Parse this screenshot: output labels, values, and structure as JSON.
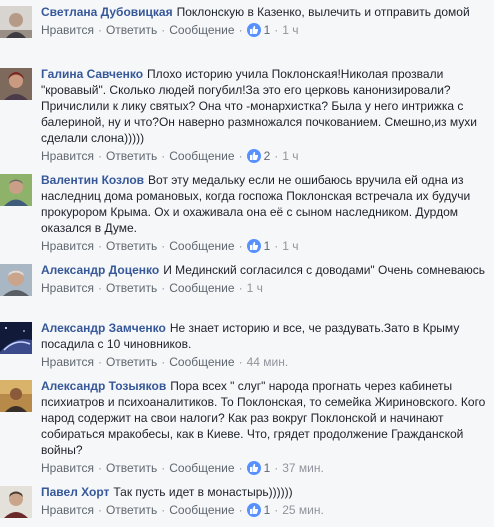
{
  "actions": {
    "like": "Нравится",
    "reply": "Ответить",
    "message": "Сообщение",
    "separator": "·",
    "like_icon": "thumbs-up-icon",
    "like_color": "#5890ff"
  },
  "comments": [
    {
      "author": "Светлана Дубовицкая",
      "text": "Поклонскую в Казенко, вылечить и отправить домой",
      "likes": "1",
      "time": "1 ч"
    },
    {
      "author": "Галина Савченко",
      "text": "Плохо историю учила Поклонская!Николая прозвали \"кровавый\". Сколько людей погубил!За это его церковь канонизировали? Причислили к лику святых? Она что -монархистка? Была у него интрижка с балериной, ну и что?Он наверно размножался почкованием. Смешно,из мухи сделали слона)))))",
      "likes": "2",
      "time": "1 ч"
    },
    {
      "author": "Валентин Козлов",
      "text": "Вот эту медальку если не ошибаюсь вручила ей одна из наследниц дома романовых, когда госпожа Поклонская встречала их будучи прокурором Крыма. Ох и охаживала она её с сыном наследником. Дурдом оказался в Думе.",
      "likes": "1",
      "time": "1 ч"
    },
    {
      "author": "Александр Доценко",
      "text": "И Мединский согласился с доводами\" Очень сомневаюсь",
      "likes": "",
      "time": "1 ч"
    },
    {
      "author": "Александр Замченко",
      "text": "Не знает историю и все, че раздувать.Зато в Крыму посадила с 10 чиновников.",
      "likes": "",
      "time": "44 мин."
    },
    {
      "author": "Александр Тозыяков",
      "text": "Пора всех \" слуг\" народа прогнать через кабинеты психиатров и психоаналитиков. То Поклонская, то семейка Жириновского. Кого народ содержит на свои налоги? Как раз вокруг Поклонской и начинают собираться мракобесы, как в Киеве. Что, грядет продолжение Гражданской войны?",
      "likes": "1",
      "time": "37 мин."
    },
    {
      "author": "Павел Хорт",
      "text": "Так пусть идет в монастырь))))))",
      "likes": "1",
      "time": "25 мин."
    }
  ]
}
